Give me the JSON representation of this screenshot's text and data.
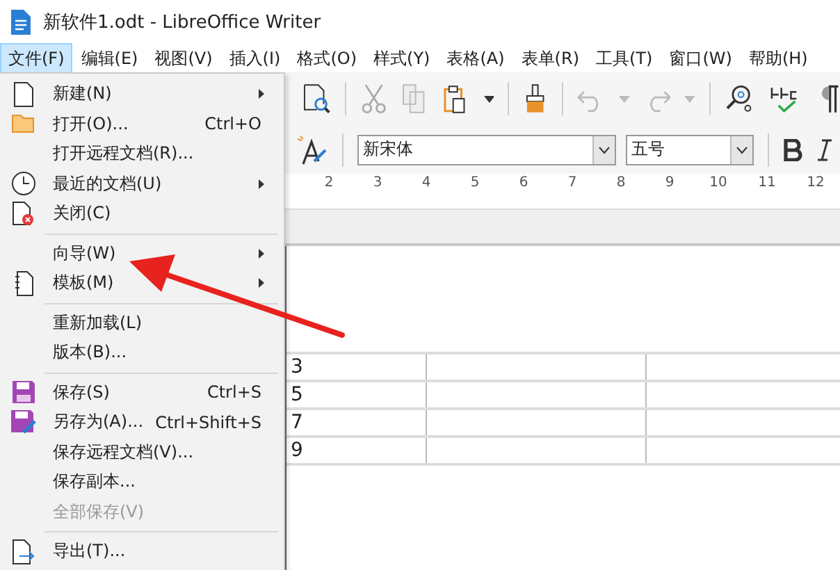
{
  "window": {
    "title": "新软件1.odt - LibreOffice Writer"
  },
  "menubar": [
    {
      "label": "文件(F)",
      "selected": true
    },
    {
      "label": "编辑(E)",
      "selected": false
    },
    {
      "label": "视图(V)",
      "selected": false
    },
    {
      "label": "插入(I)",
      "selected": false
    },
    {
      "label": "格式(O)",
      "selected": false
    },
    {
      "label": "样式(Y)",
      "selected": false
    },
    {
      "label": "表格(A)",
      "selected": false
    },
    {
      "label": "表单(R)",
      "selected": false
    },
    {
      "label": "工具(T)",
      "selected": false
    },
    {
      "label": "窗口(W)",
      "selected": false
    },
    {
      "label": "帮助(H)",
      "selected": false
    }
  ],
  "file_menu": [
    {
      "kind": "item",
      "label": "新建(N)",
      "submenu": true,
      "disabled": false
    },
    {
      "kind": "item",
      "label": "打开(O)...",
      "shortcut": "Ctrl+O",
      "submenu": false,
      "disabled": false
    },
    {
      "kind": "item",
      "label": "打开远程文档(R)...",
      "submenu": false,
      "disabled": false
    },
    {
      "kind": "item",
      "label": "最近的文档(U)",
      "submenu": true,
      "disabled": false
    },
    {
      "kind": "item",
      "label": "关闭(C)",
      "submenu": false,
      "disabled": false
    },
    {
      "kind": "separator"
    },
    {
      "kind": "item",
      "label": "向导(W)",
      "submenu": true,
      "disabled": false
    },
    {
      "kind": "item",
      "label": "模板(M)",
      "submenu": true,
      "disabled": false
    },
    {
      "kind": "separator"
    },
    {
      "kind": "item",
      "label": "重新加载(L)",
      "submenu": false,
      "disabled": false
    },
    {
      "kind": "item",
      "label": "版本(B)...",
      "submenu": false,
      "disabled": false
    },
    {
      "kind": "separator"
    },
    {
      "kind": "item",
      "label": "保存(S)",
      "shortcut": "Ctrl+S",
      "submenu": false,
      "disabled": false
    },
    {
      "kind": "item",
      "label": "另存为(A)...",
      "shortcut": "Ctrl+Shift+S",
      "submenu": false,
      "disabled": false
    },
    {
      "kind": "item",
      "label": "保存远程文档(V)...",
      "submenu": false,
      "disabled": false
    },
    {
      "kind": "item",
      "label": "保存副本...",
      "submenu": false,
      "disabled": false
    },
    {
      "kind": "item",
      "label": "全部保存(V)",
      "submenu": false,
      "disabled": true
    },
    {
      "kind": "separator"
    },
    {
      "kind": "item",
      "label": "导出(T)...",
      "submenu": false,
      "disabled": false
    }
  ],
  "toolbar": {
    "font_name": "新宋体",
    "font_size": "五号"
  },
  "ruler": {
    "labels": [
      "2",
      "3",
      "4",
      "5",
      "6",
      "7",
      "8",
      "9",
      "10",
      "11",
      "12"
    ]
  },
  "table": {
    "rows": [
      {
        "column_1": "3"
      },
      {
        "column_1": "5"
      },
      {
        "column_1": "7"
      },
      {
        "column_1": "9"
      }
    ]
  }
}
